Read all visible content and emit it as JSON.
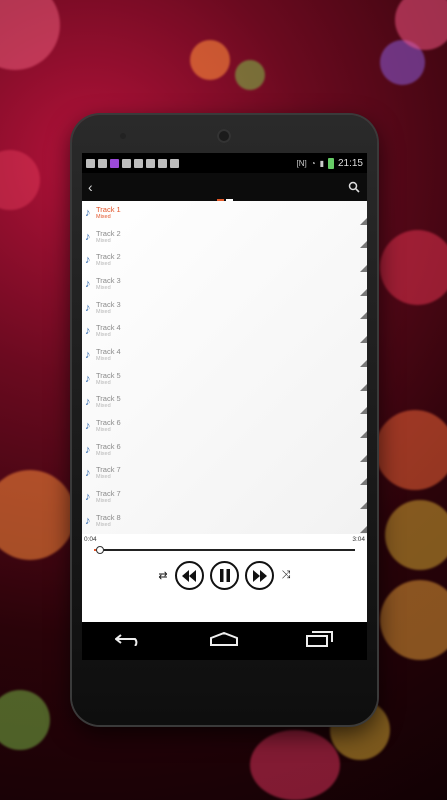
{
  "status_bar": {
    "time": "21:15"
  },
  "action_bar": {
    "back_icon": "chevron-left-icon",
    "search_icon": "search-icon"
  },
  "tracks": [
    {
      "title": "Track 1",
      "artist": "Mixed",
      "active": true
    },
    {
      "title": "Track 2",
      "artist": "Mixed"
    },
    {
      "title": "Track 2",
      "artist": "Mixed"
    },
    {
      "title": "Track 3",
      "artist": "Mixed"
    },
    {
      "title": "Track 3",
      "artist": "Mixed"
    },
    {
      "title": "Track 4",
      "artist": "Mixed"
    },
    {
      "title": "Track 4",
      "artist": "Mixed"
    },
    {
      "title": "Track 5",
      "artist": "Mixed"
    },
    {
      "title": "Track 5",
      "artist": "Mixed"
    },
    {
      "title": "Track 6",
      "artist": "Mixed"
    },
    {
      "title": "Track 6",
      "artist": "Mixed"
    },
    {
      "title": "Track 7",
      "artist": "Mixed"
    },
    {
      "title": "Track 7",
      "artist": "Mixed"
    },
    {
      "title": "Track 8",
      "artist": "Mixed"
    }
  ],
  "player": {
    "elapsed": "0:04",
    "duration": "3:04",
    "progress_fraction": 0.02
  },
  "colors": {
    "accent": "#e2552a",
    "note": "#3a6fb0"
  }
}
